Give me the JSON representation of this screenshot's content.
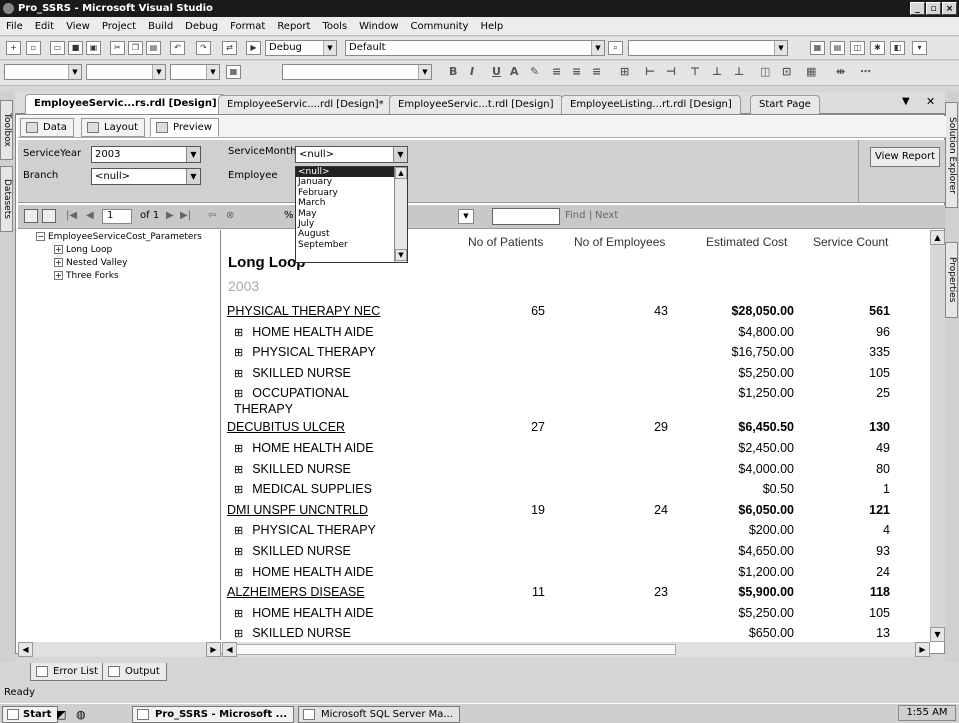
{
  "window": {
    "title": "Pro_SSRS - Microsoft Visual Studio",
    "min": "_",
    "max": "▫",
    "close": "×"
  },
  "menu": [
    "File",
    "Edit",
    "View",
    "Project",
    "Build",
    "Debug",
    "Format",
    "Report",
    "Tools",
    "Window",
    "Community",
    "Help"
  ],
  "toolbar": {
    "config": "Debug",
    "platform": "Default"
  },
  "doc_tabs": [
    "EmployeeServic...rs.rdl [Design]",
    "EmployeeServic....rdl [Design]*",
    "EmployeeServic...t.rdl [Design]",
    "EmployeeListing...rt.rdl [Design]",
    "Start Page"
  ],
  "tab_controls": {
    "pin": "▼",
    "close": "✕"
  },
  "sub_tabs": [
    "Data",
    "Layout",
    "Preview"
  ],
  "side_tabs": {
    "left": [
      "Toolbox",
      "Datasets"
    ],
    "right": [
      "Solution Explorer",
      "Properties"
    ]
  },
  "params": {
    "service_year_label": "ServiceYear",
    "service_year_value": "2003",
    "service_month_label": "ServiceMonth",
    "service_month_value": "<null>",
    "branch_label": "Branch",
    "branch_value": "<null>",
    "employee_label": "Employee",
    "view_report": "View Report"
  },
  "dropdown_items": [
    "<null>",
    "January",
    "February",
    "March",
    "May",
    "July",
    "August",
    "September"
  ],
  "report_toolbar": {
    "page": "1",
    "of_pages": "of 1",
    "zoom_suffix": "%",
    "find": "Find",
    "next": "Next",
    "sep": "|"
  },
  "doc_map": {
    "root": "EmployeeServiceCost_Parameters",
    "items": [
      "Long Loop",
      "Nested Valley",
      "Three Forks"
    ]
  },
  "report": {
    "headers": {
      "patients": "No of Patients",
      "employees": "No of Employees",
      "cost": "Estimated Cost",
      "count": "Service Count"
    },
    "title": "Long Loop",
    "year": "2003",
    "rows": [
      {
        "kind": "parent",
        "label": "PHYSICAL THERAPY NEC",
        "patients": "65",
        "employees": "43",
        "cost": "$28,050.00",
        "count": "561"
      },
      {
        "kind": "child",
        "label": "HOME HEALTH AIDE",
        "cost": "$4,800.00",
        "count": "96"
      },
      {
        "kind": "child",
        "label": "PHYSICAL THERAPY",
        "cost": "$16,750.00",
        "count": "335"
      },
      {
        "kind": "child",
        "label": "SKILLED NURSE",
        "cost": "$5,250.00",
        "count": "105"
      },
      {
        "kind": "child",
        "label": "OCCUPATIONAL THERAPY",
        "cost": "$1,250.00",
        "count": "25",
        "two_line": true
      },
      {
        "kind": "parent",
        "label": "DECUBITUS ULCER",
        "patients": "27",
        "employees": "29",
        "cost": "$6,450.50",
        "count": "130"
      },
      {
        "kind": "child",
        "label": "HOME HEALTH AIDE",
        "cost": "$2,450.00",
        "count": "49"
      },
      {
        "kind": "child",
        "label": "SKILLED NURSE",
        "cost": "$4,000.00",
        "count": "80"
      },
      {
        "kind": "child",
        "label": "MEDICAL SUPPLIES",
        "cost": "$0.50",
        "count": "1"
      },
      {
        "kind": "parent",
        "label": "DMI UNSPF UNCNTRLD",
        "patients": "19",
        "employees": "24",
        "cost": "$6,050.00",
        "count": "121"
      },
      {
        "kind": "child",
        "label": "PHYSICAL THERAPY",
        "cost": "$200.00",
        "count": "4"
      },
      {
        "kind": "child",
        "label": "SKILLED NURSE",
        "cost": "$4,650.00",
        "count": "93"
      },
      {
        "kind": "child",
        "label": "HOME HEALTH AIDE",
        "cost": "$1,200.00",
        "count": "24"
      },
      {
        "kind": "parent",
        "label": "ALZHEIMERS DISEASE",
        "patients": "11",
        "employees": "23",
        "cost": "$5,900.00",
        "count": "118"
      },
      {
        "kind": "child",
        "label": "HOME HEALTH AIDE",
        "cost": "$5,250.00",
        "count": "105"
      },
      {
        "kind": "child",
        "label": "SKILLED NURSE",
        "cost": "$650.00",
        "count": "13"
      }
    ]
  },
  "bottom_tabs": [
    "Error List",
    "Output"
  ],
  "status": "Ready",
  "taskbar": {
    "start": "Start",
    "tasks": [
      "Pro_SSRS - Microsoft ...",
      "Microsoft SQL Server Ma..."
    ],
    "clock": "1:55 AM"
  }
}
